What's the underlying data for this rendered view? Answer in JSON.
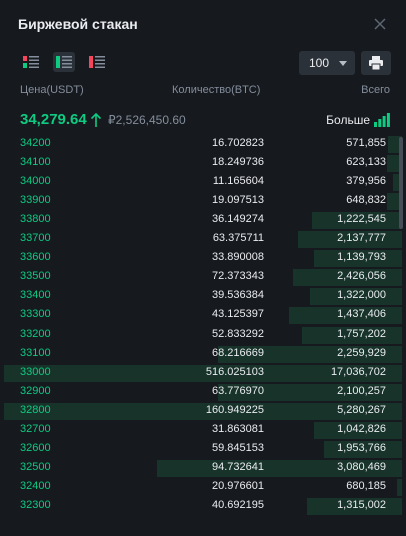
{
  "header": {
    "title": "Биржевой стакан"
  },
  "toolbar": {
    "depth": "100"
  },
  "columns": {
    "price": "Цена(USDT)",
    "amount": "Количество(BTC)",
    "total": "Всего"
  },
  "ticker": {
    "last_price": "34,279.64",
    "fiat_price": "₽2,526,450.60",
    "more_label": "Больше"
  },
  "colors": {
    "buy": "#0ecb81",
    "bar": "#17332a",
    "background": "#16191e",
    "text": "#eaecef",
    "muted": "#848e9c"
  },
  "orders": [
    {
      "price": "34200",
      "amount": "16.702823",
      "total": "571,855",
      "depth": 0.034
    },
    {
      "price": "34100",
      "amount": "18.249736",
      "total": "623,133",
      "depth": 0.037
    },
    {
      "price": "34000",
      "amount": "11.165604",
      "total": "379,956",
      "depth": 0.022
    },
    {
      "price": "33900",
      "amount": "19.097513",
      "total": "648,832",
      "depth": 0.038
    },
    {
      "price": "33800",
      "amount": "36.149274",
      "total": "1,222,545",
      "depth": 0.226
    },
    {
      "price": "33700",
      "amount": "63.375711",
      "total": "2,137,777",
      "depth": 0.262
    },
    {
      "price": "33600",
      "amount": "33.890008",
      "total": "1,139,793",
      "depth": 0.221
    },
    {
      "price": "33500",
      "amount": "72.373343",
      "total": "2,426,056",
      "depth": 0.275
    },
    {
      "price": "33400",
      "amount": "39.536384",
      "total": "1,322,000",
      "depth": 0.231
    },
    {
      "price": "33300",
      "amount": "43.125397",
      "total": "1,437,406",
      "depth": 0.284
    },
    {
      "price": "33200",
      "amount": "52.833292",
      "total": "1,757,202",
      "depth": 0.252
    },
    {
      "price": "33100",
      "amount": "68.216669",
      "total": "2,259,929",
      "depth": 0.462
    },
    {
      "price": "33000",
      "amount": "516.025103",
      "total": "17,036,702",
      "depth": 1.0
    },
    {
      "price": "32900",
      "amount": "63.776970",
      "total": "2,100,257",
      "depth": 0.462
    },
    {
      "price": "32800",
      "amount": "160.949225",
      "total": "5,280,267",
      "depth": 1.0
    },
    {
      "price": "32700",
      "amount": "31.863081",
      "total": "1,042,826",
      "depth": 0.221
    },
    {
      "price": "32600",
      "amount": "59.845153",
      "total": "1,953,766",
      "depth": 0.196
    },
    {
      "price": "32500",
      "amount": "94.732641",
      "total": "3,080,469",
      "depth": 0.615
    },
    {
      "price": "32400",
      "amount": "20.976601",
      "total": "680,185",
      "depth": 0.013
    },
    {
      "price": "32300",
      "amount": "40.692195",
      "total": "1,315,002",
      "depth": 0.239
    }
  ]
}
